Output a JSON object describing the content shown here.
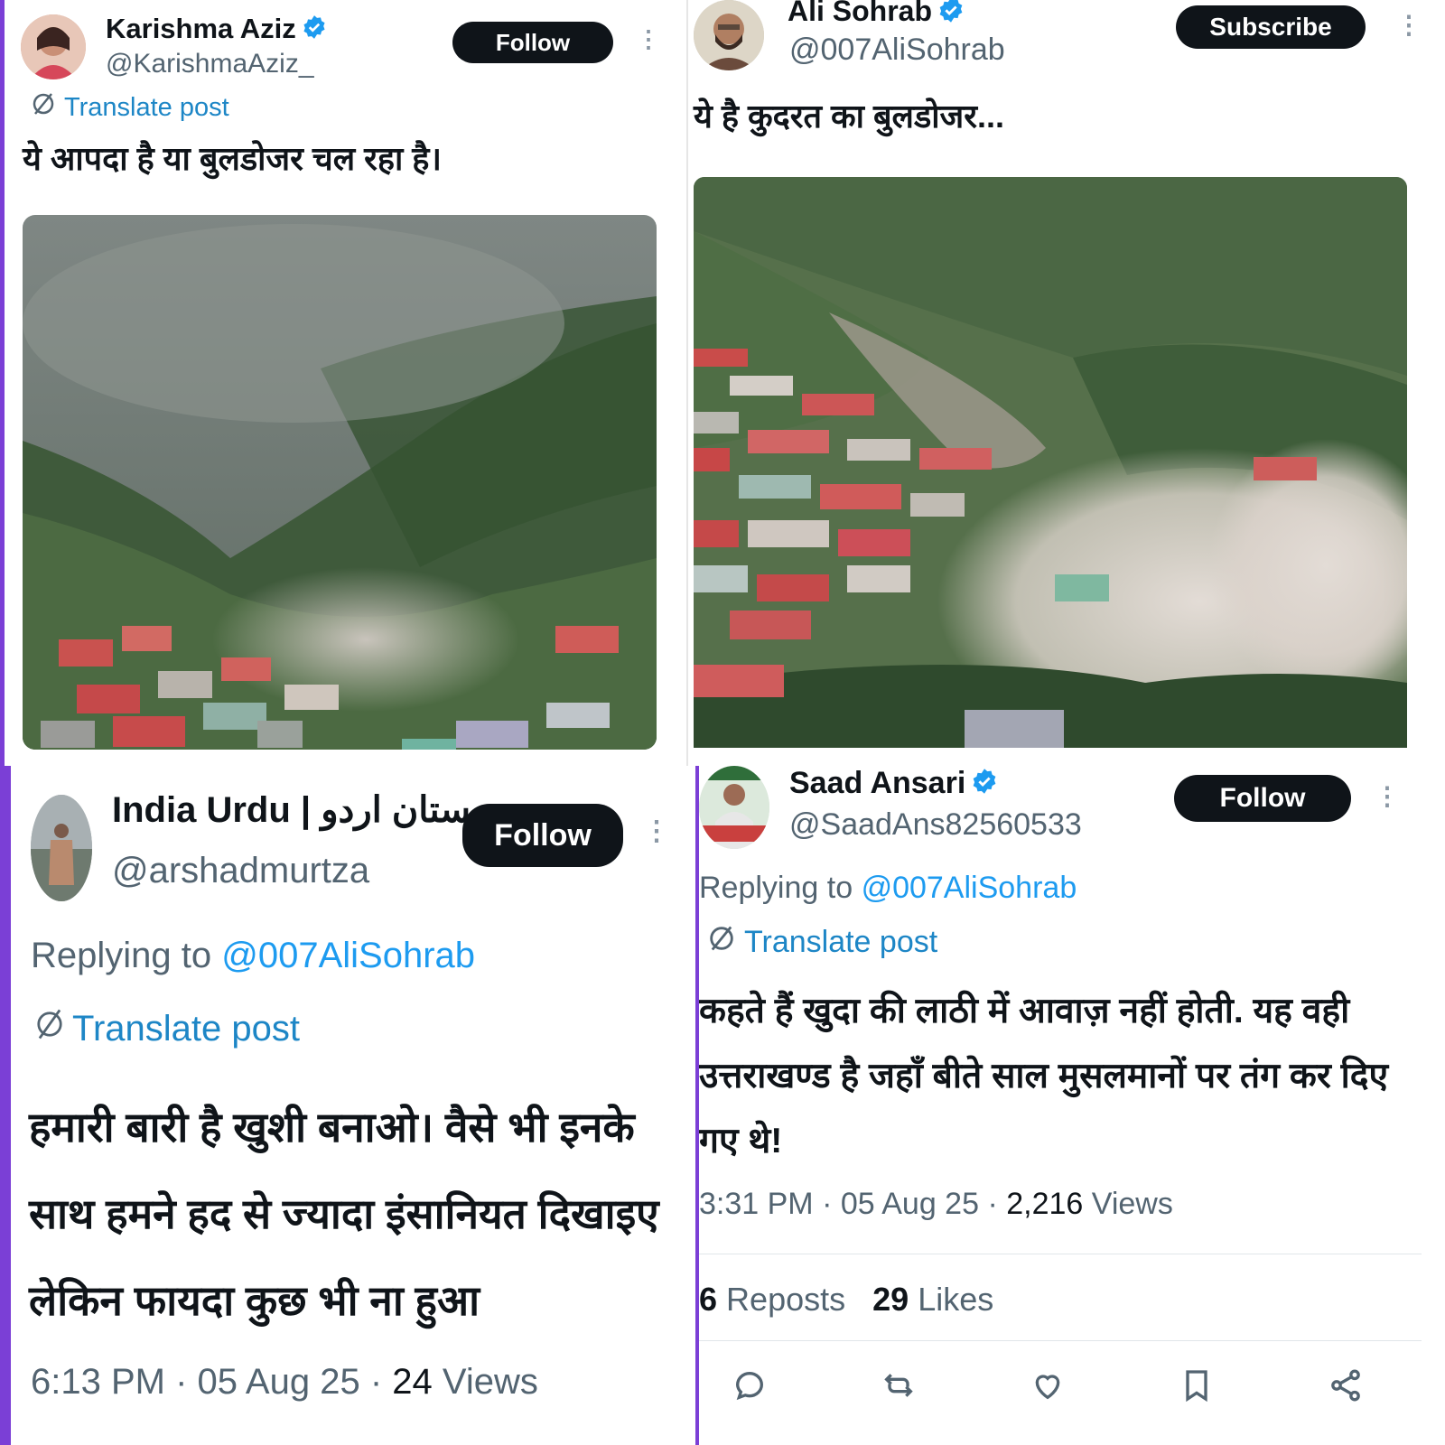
{
  "colors": {
    "accent": "#1d9bf0",
    "frame": "#7b3fd6",
    "button": "#0f1419"
  },
  "post1": {
    "name": "Karishma Aziz",
    "handle": "@KarishmaAziz_",
    "follow_label": "Follow",
    "translate_label": "Translate post",
    "text": "ये आपदा है या बुलडोजर चल रहा है।"
  },
  "post2": {
    "name": "Ali Sohrab",
    "handle": "@007AliSohrab",
    "subscribe_label": "Subscribe",
    "text": "ये है कुदरत का बुलडोजर..."
  },
  "post3": {
    "name": "India Urdu | ہندوستان اردو",
    "handle": "@arshadmurtza",
    "follow_label": "Follow",
    "replying_prefix": "Replying to",
    "replying_handle": "@007AliSohrab",
    "translate_label": "Translate post",
    "text": "हमारी बारी है खुशी बनाओ। वैसे भी इनके साथ हमने हद से ज्यादा इंसानियत दिखाइए लेकिन फायदा कुछ भी ना हुआ",
    "time": "6:13 PM",
    "date": "05 Aug 25",
    "views_count": "24",
    "views_label": "Views"
  },
  "post4": {
    "name": "Saad Ansari",
    "handle": "@SaadAns82560533",
    "follow_label": "Follow",
    "replying_prefix": "Replying to",
    "replying_handle": "@007AliSohrab",
    "translate_label": "Translate post",
    "text": "कहते हैं खुदा की लाठी में आवाज़ नहीं होती. यह वही उत्तराखण्ड है जहाँ बीते साल मुसलमानों पर तंग कर दिए गए थे!",
    "time": "3:31 PM",
    "date": "05 Aug 25",
    "views_count": "2,216",
    "views_label": "Views",
    "reposts_count": "6",
    "reposts_label": "Reposts",
    "likes_count": "29",
    "likes_label": "Likes",
    "action_icons": [
      "reply-icon",
      "repost-icon",
      "like-icon",
      "bookmark-icon",
      "share-icon"
    ]
  }
}
